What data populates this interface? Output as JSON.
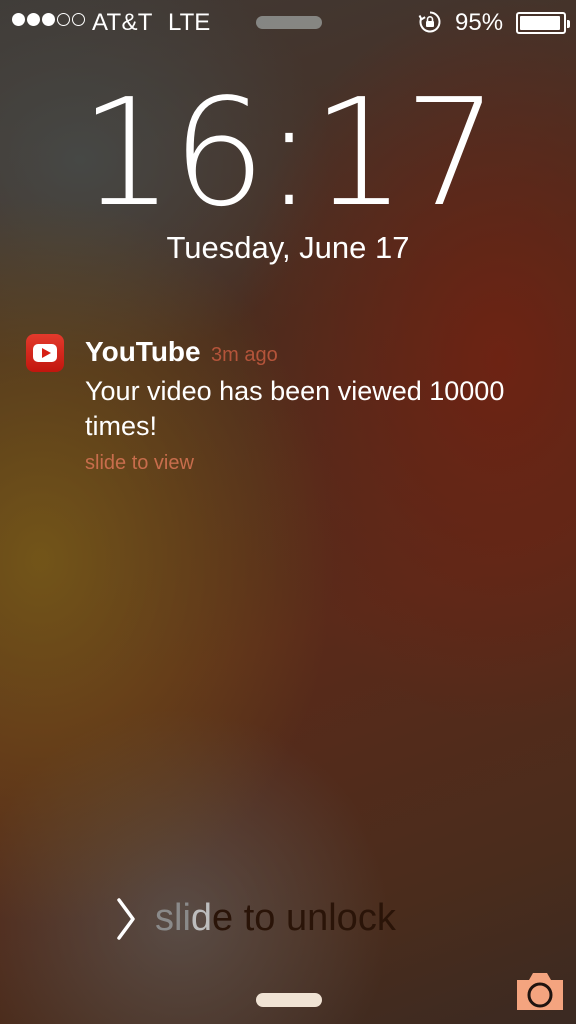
{
  "status_bar": {
    "signal_bars_filled": 3,
    "signal_bars_total": 5,
    "carrier": "AT&T",
    "network": "LTE",
    "battery_percent": "95%",
    "battery_level": 0.95,
    "rotation_lock_icon": "rotation-lock-icon"
  },
  "lock_screen": {
    "time": "16:17",
    "date": "Tuesday, June 17"
  },
  "notification": {
    "app_name": "YouTube",
    "app_icon": "youtube-icon",
    "time_ago": "3m ago",
    "message": "Your video has been viewed 10000 times!",
    "action": "slide to view",
    "colors": {
      "time": "#b4543a",
      "action": "#c86d4c",
      "icon": "#d61f15"
    }
  },
  "unlock": {
    "label_dim": "sli",
    "label_shine": "d",
    "label_rest": "e to unlock",
    "chevron_icon": "chevron-right-icon"
  },
  "camera": {
    "icon": "camera-icon",
    "color": "#f4a47f"
  }
}
